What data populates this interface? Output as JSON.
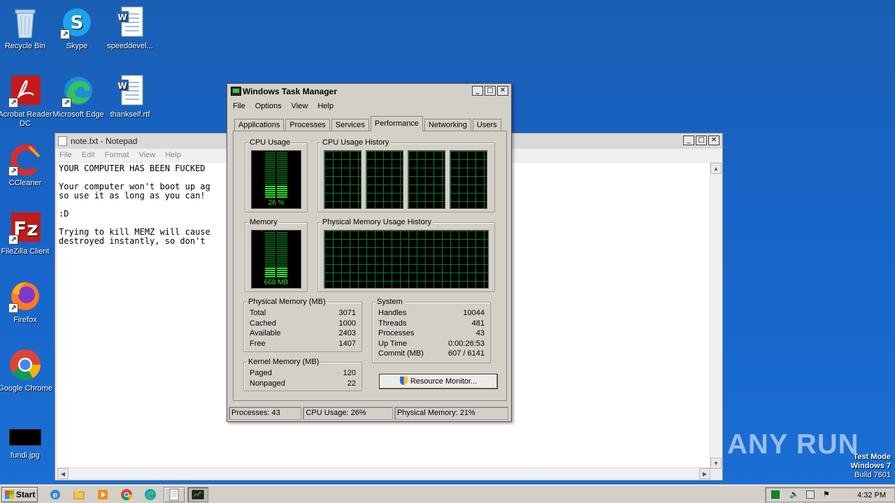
{
  "desktop": {
    "icons": [
      {
        "label": "Recycle Bin"
      },
      {
        "label": "Skype"
      },
      {
        "label": "speeddevel..."
      },
      {
        "label": "Acrobat Reader DC"
      },
      {
        "label": "Microsoft Edge"
      },
      {
        "label": "thankself.rtf"
      },
      {
        "label": "CCleaner"
      },
      {
        "label": "FileZilla Client"
      },
      {
        "label": "Firefox"
      },
      {
        "label": "Google Chrome"
      },
      {
        "label": "fundi.jpg"
      }
    ]
  },
  "notepad": {
    "title": "note.txt - Notepad",
    "menu": [
      "File",
      "Edit",
      "Format",
      "View",
      "Help"
    ],
    "content": "YOUR COMPUTER HAS BEEN FUCKED \n\nYour computer won't boot up ag\nso use it as long as you can!\n\n:D\n\nTrying to kill MEMZ will cause\ndestroyed instantly, so don't "
  },
  "taskmgr": {
    "title": "Windows Task Manager",
    "menu": [
      "File",
      "Options",
      "View",
      "Help"
    ],
    "tabs": [
      "Applications",
      "Processes",
      "Services",
      "Performance",
      "Networking",
      "Users"
    ],
    "active_tab": "Performance",
    "groups": {
      "cpu_usage": "CPU Usage",
      "cpu_history": "CPU Usage History",
      "memory": "Memory",
      "mem_history": "Physical Memory Usage History",
      "physical": "Physical Memory (MB)",
      "kernel": "Kernel Memory (MB)",
      "system": "System"
    },
    "cpu_value": "26 %",
    "cpu_fraction": 0.26,
    "memory_value": "668 MB",
    "memory_fraction": 0.21,
    "physical_memory": [
      {
        "label": "Total",
        "value": "3071"
      },
      {
        "label": "Cached",
        "value": "1000"
      },
      {
        "label": "Available",
        "value": "2403"
      },
      {
        "label": "Free",
        "value": "1407"
      }
    ],
    "kernel_memory": [
      {
        "label": "Paged",
        "value": "120"
      },
      {
        "label": "Nonpaged",
        "value": "22"
      }
    ],
    "system": [
      {
        "label": "Handles",
        "value": "10044"
      },
      {
        "label": "Threads",
        "value": "481"
      },
      {
        "label": "Processes",
        "value": "43"
      },
      {
        "label": "Up Time",
        "value": "0:00:26:53"
      },
      {
        "label": "Commit (MB)",
        "value": "607 / 6141"
      }
    ],
    "resource_monitor_label": "Resource Monitor...",
    "status": {
      "processes": "Processes: 43",
      "cpu": "CPU Usage: 26%",
      "memory": "Physical Memory: 21%"
    }
  },
  "watermark": "ANY RUN",
  "test_mode": {
    "line1": "Test Mode",
    "line2": "Windows 7",
    "line3": "Build 7601"
  },
  "taskbar": {
    "start_label": "Start",
    "clock": "4:32 PM"
  }
}
